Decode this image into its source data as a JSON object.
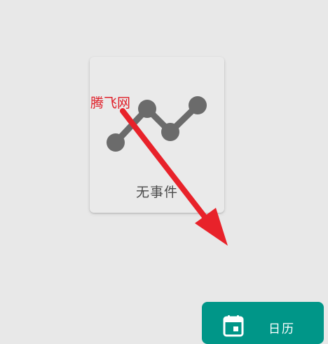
{
  "empty_state": {
    "icon": "timeline-chart-icon",
    "label": "无事件"
  },
  "watermark": {
    "text": "腾飞网"
  },
  "calendar_button": {
    "icon": "calendar-icon",
    "label": "日历"
  },
  "colors": {
    "background": "#e8e8e8",
    "card": "#eaeaea",
    "icon_gray": "#6b6b6b",
    "watermark_red": "#e0202a",
    "arrow_red": "#e8222a",
    "button_teal": "#009688"
  }
}
